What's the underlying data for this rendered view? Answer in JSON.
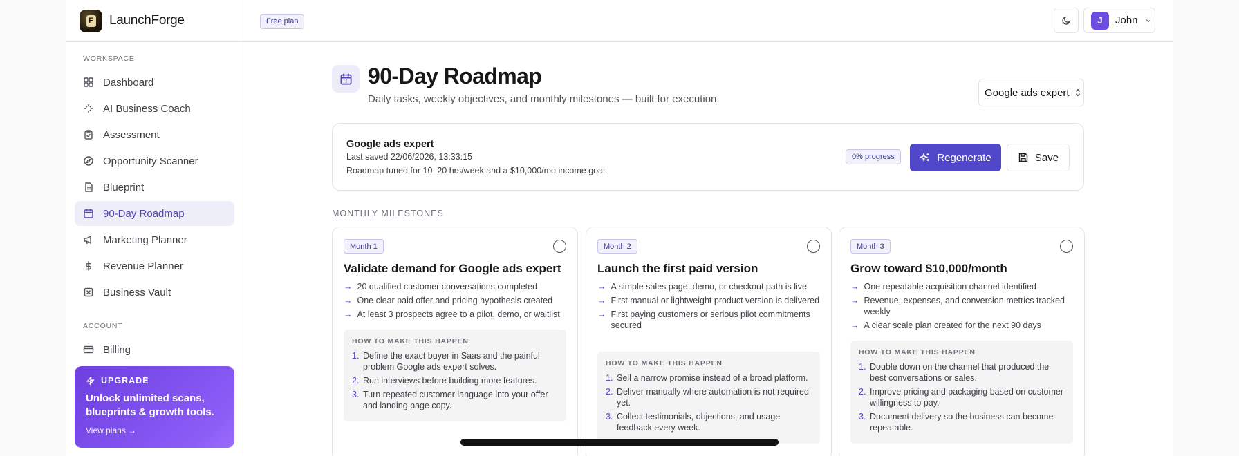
{
  "brand": {
    "name": "LaunchForge",
    "logo_letter": "F"
  },
  "sidebar": {
    "workspace_label": "WORKSPACE",
    "items": [
      {
        "label": "Dashboard",
        "icon": "grid-icon"
      },
      {
        "label": "AI Business Coach",
        "icon": "sparkle-brain-icon"
      },
      {
        "label": "Assessment",
        "icon": "clipboard-check-icon"
      },
      {
        "label": "Opportunity Scanner",
        "icon": "compass-icon"
      },
      {
        "label": "Blueprint",
        "icon": "document-icon"
      },
      {
        "label": "90-Day Roadmap",
        "icon": "calendar-icon",
        "active": true
      },
      {
        "label": "Marketing Planner",
        "icon": "megaphone-icon"
      },
      {
        "label": "Revenue Planner",
        "icon": "dollar-icon"
      },
      {
        "label": "Business Vault",
        "icon": "vault-icon"
      }
    ],
    "account_label": "ACCOUNT",
    "account_items": [
      {
        "label": "Billing",
        "icon": "credit-card-icon"
      }
    ],
    "upgrade": {
      "tag": "UPGRADE",
      "text": "Unlock unlimited scans, blueprints & growth tools.",
      "link": "View plans →"
    }
  },
  "topbar": {
    "plan_badge": "Free plan",
    "user_initial": "J",
    "user_name": "John"
  },
  "page": {
    "title": "90-Day Roadmap",
    "subtitle": "Daily tasks, weekly objectives, and monthly milestones — built for execution.",
    "selector_value": "Google ads expert"
  },
  "info": {
    "title": "Google ads expert",
    "saved": "Last saved 22/06/2026, 13:33:15",
    "note": "Roadmap tuned for 10–20 hrs/week and a $10,000/mo income goal.",
    "progress": "0% progress",
    "regenerate_label": "Regenerate",
    "save_label": "Save"
  },
  "milestones_label": "MONTHLY MILESTONES",
  "how_label": "HOW TO MAKE THIS HAPPEN",
  "months": [
    {
      "badge": "Month 1",
      "title": "Validate demand for Google ads expert",
      "goals": [
        "20 qualified customer conversations completed",
        "One clear paid offer and pricing hypothesis created",
        "At least 3 prospects agree to a pilot, demo, or waitlist"
      ],
      "steps": [
        "Define the exact buyer in Saas and the painful problem Google ads expert solves.",
        "Run interviews before building more features.",
        "Turn repeated customer language into your offer and landing page copy."
      ]
    },
    {
      "badge": "Month 2",
      "title": "Launch the first paid version",
      "goals": [
        "A simple sales page, demo, or checkout path is live",
        "First manual or lightweight product version is delivered",
        "First paying customers or serious pilot commitments secured"
      ],
      "steps": [
        "Sell a narrow promise instead of a broad platform.",
        "Deliver manually where automation is not required yet.",
        "Collect testimonials, objections, and usage feedback every week."
      ]
    },
    {
      "badge": "Month 3",
      "title": "Grow toward $10,000/month",
      "goals": [
        "One repeatable acquisition channel identified",
        "Revenue, expenses, and conversion metrics tracked weekly",
        "A clear scale plan created for the next 90 days"
      ],
      "steps": [
        "Double down on the channel that produced the best conversations or sales.",
        "Improve pricing and packaging based on customer willingness to pay.",
        "Document delivery so the business can become repeatable."
      ]
    }
  ]
}
